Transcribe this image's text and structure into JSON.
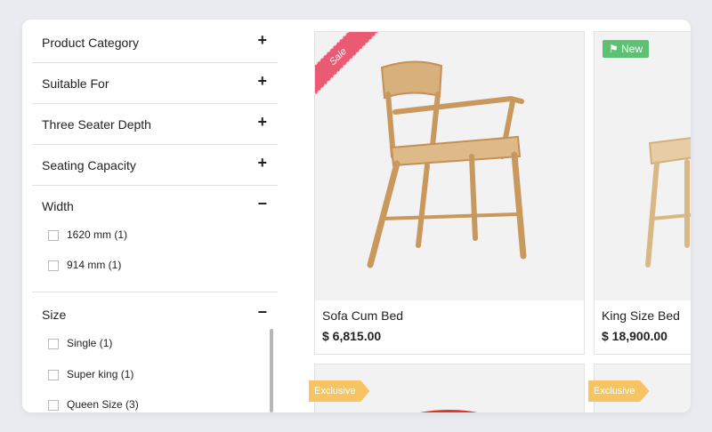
{
  "filters": {
    "collapsed": [
      {
        "label": "Product Category",
        "toggle": "+"
      },
      {
        "label": "Suitable For",
        "toggle": "+"
      },
      {
        "label": "Three Seater Depth",
        "toggle": "+"
      },
      {
        "label": "Seating Capacity",
        "toggle": "+"
      }
    ],
    "width": {
      "label": "Width",
      "toggle": "−",
      "options": [
        {
          "text": "1620 mm  (1)"
        },
        {
          "text": "914 mm  (1)"
        }
      ]
    },
    "size": {
      "label": "Size",
      "toggle": "−",
      "options": [
        {
          "text": "Single  (1)"
        },
        {
          "text": "Super king  (1)"
        },
        {
          "text": "Queen Size  (3)"
        }
      ]
    }
  },
  "products": [
    {
      "name": "Sofa Cum Bed",
      "price": "$ 6,815.00",
      "badge": "Sale"
    },
    {
      "name": "King Size Bed",
      "price": "$ 18,900.00",
      "badge": "New"
    },
    {
      "badge": "Exclusive"
    },
    {
      "badge": "Exclusive"
    }
  ],
  "colors": {
    "sale": "#ea5b73",
    "new": "#5dc174",
    "exclusive": "#f6c462"
  }
}
